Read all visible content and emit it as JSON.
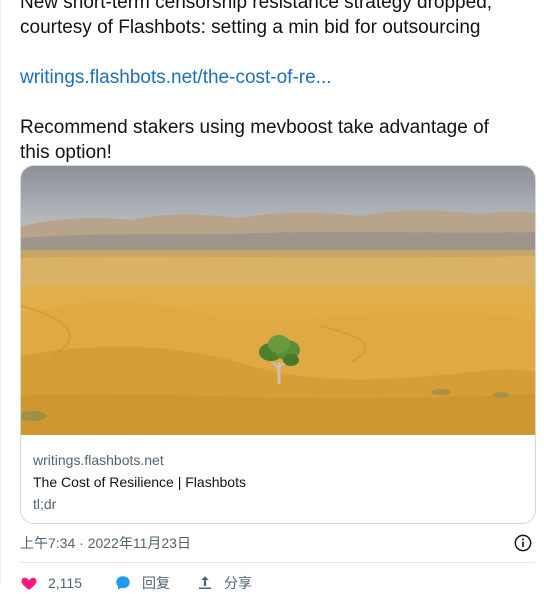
{
  "tweet": {
    "line1": "New short-term censorship resistance strategy dropped,",
    "line2": "courtesy of Flashbots: setting a min bid for outsourcing",
    "link": "writings.flashbots.net/the-cost-of-re...",
    "line3": "Recommend stakers using mevboost take advantage of",
    "line4": "this option!"
  },
  "card": {
    "domain": "writings.flashbots.net",
    "title": "The Cost of Resilience | Flashbots",
    "description": "tl;dr"
  },
  "timestamp": "上午7:34 · 2022年11月23日",
  "actions": {
    "like_count": "2,115",
    "reply_label": "回复",
    "share_label": "分享"
  },
  "colors": {
    "link": "#1d6fb8",
    "like": "#f91880",
    "reply": "#1d9bf0"
  }
}
